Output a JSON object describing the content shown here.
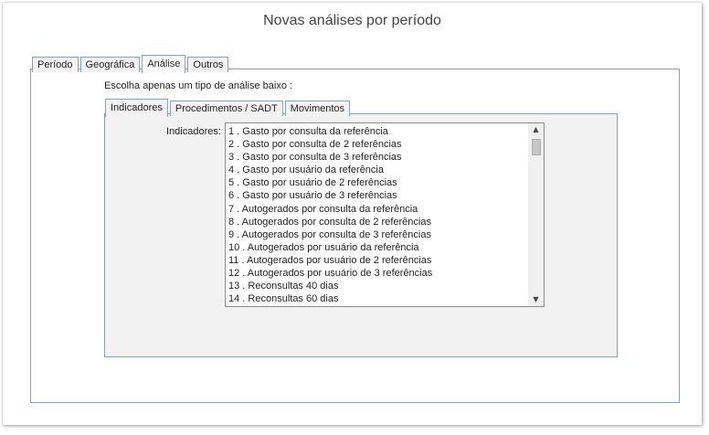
{
  "window": {
    "title": "Novas análises por período"
  },
  "outer_tabs": [
    {
      "label": "Período"
    },
    {
      "label": "Geográfica"
    },
    {
      "label": "Análise"
    },
    {
      "label": "Outros"
    }
  ],
  "instruction": "Escolha apenas um tipo de análise baixo :",
  "inner_tabs": [
    {
      "label": "Indicadores"
    },
    {
      "label": "Procedimentos / SADT"
    },
    {
      "label": "Movimentos"
    }
  ],
  "indicators": {
    "label": "Indicadores:",
    "items": [
      "1 . Gasto por consulta da referência",
      "2 . Gasto por consulta de 2 referências",
      "3 . Gasto por consulta de 3 referências",
      "4 . Gasto por usuário da referência",
      "5 . Gasto por usuário de 2 referências",
      "6 . Gasto por usuário de 3 referências",
      "7 . Autogerados por consulta da referência",
      "8 . Autogerados por consulta de 2 referências",
      "9 . Autogerados por consulta de 3 referências",
      "10 . Autogerados por usuário da referência",
      "11 . Autogerados por usuário de 2 referências",
      "12 . Autogerados por usuário de 3 referências",
      "13 . Reconsultas 40 dias",
      "14 . Reconsultas 60 dias"
    ]
  },
  "icons": {
    "scroll_up": "triangle-up",
    "scroll_down": "triangle-down"
  }
}
